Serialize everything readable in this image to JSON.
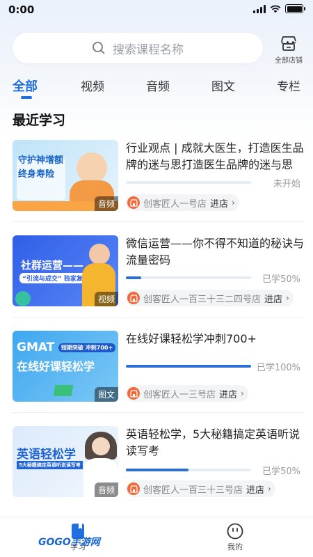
{
  "status_bar": {
    "time": "0:00"
  },
  "search": {
    "placeholder": "搜索课程名称",
    "icon": "search-icon"
  },
  "store_entry": {
    "label": "全部店铺",
    "icon": "store-icon"
  },
  "tabs": [
    {
      "label": "全部",
      "active": true
    },
    {
      "label": "视频",
      "active": false
    },
    {
      "label": "音频",
      "active": false
    },
    {
      "label": "图文",
      "active": false
    },
    {
      "label": "专栏",
      "active": false
    }
  ],
  "section_title": "最近学习",
  "courses": [
    {
      "title": "行业观点 | 成就大医生，打造医生品牌的迷与思打造医生品牌的迷与思",
      "type_badge": "音频",
      "thumb_text": [
        "守护神增额",
        "终身寿险"
      ],
      "progress": 0,
      "progress_text": "未开始",
      "shop": "创客匠人一号店",
      "enter": "进店"
    },
    {
      "title": "微信运营——你不得不知道的秘诀与流量密码",
      "type_badge": "视频",
      "thumb_text": [
        "社群运营——",
        "“引流与成交” 独家复盘"
      ],
      "progress": 0.12,
      "progress_text": "已学50%",
      "shop": "创客匠人一百三十三二四号店",
      "enter": "进店"
    },
    {
      "title": "在线好课轻松学冲刺700+",
      "type_badge": "图文",
      "thumb_text": [
        "GMAT",
        "在线好课轻松学",
        "短期突破 冲刺700+"
      ],
      "progress": 1.0,
      "progress_text": "已学100%",
      "shop": "创客匠人一三号店",
      "enter": "进店"
    },
    {
      "title": "英语轻松学，5大秘籍搞定英语听说读写考",
      "type_badge": "音频",
      "thumb_text": [
        "英语轻松学",
        "5大秘籍搞定英语听说读写考"
      ],
      "progress": 0.5,
      "progress_text": "已学50%",
      "shop": "创客匠人一百三十三号店",
      "enter": "进店"
    }
  ],
  "bottom_nav": [
    {
      "label": "学习",
      "icon": "book-icon",
      "active": true
    },
    {
      "label": "我的",
      "icon": "profile-icon",
      "active": false
    }
  ],
  "watermark": {
    "text": "GOGO手游网"
  },
  "colors": {
    "accent": "#1f6fe0",
    "shop_icon": "#f06a3b"
  }
}
